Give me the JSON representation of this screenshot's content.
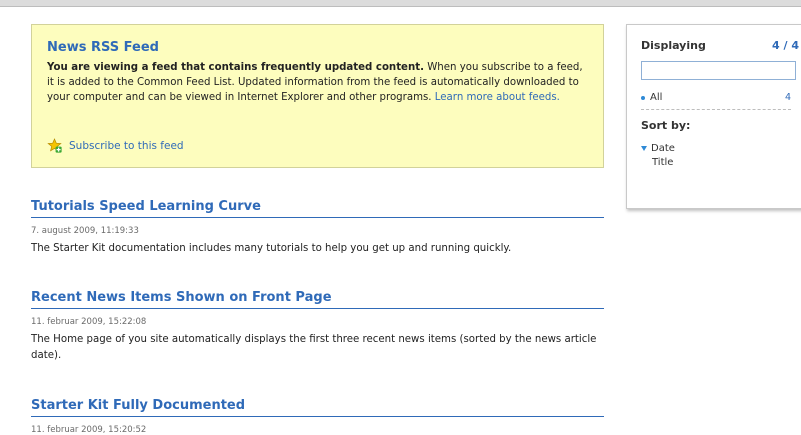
{
  "notice": {
    "title": "News RSS Feed",
    "bold_text": "You are viewing a feed that contains frequently updated content.",
    "text": " When you subscribe to a feed, it is added to the Common Feed List. Updated information from the feed is automatically downloaded to your computer and can be viewed in Internet Explorer and other programs. ",
    "learn_more": "Learn more about feeds.",
    "subscribe_label": "Subscribe to this feed"
  },
  "items": [
    {
      "title": "Tutorials Speed Learning Curve",
      "date": "7. august 2009, 11:19:33",
      "description": "The Starter Kit documentation includes many tutorials to help you get up and running quickly."
    },
    {
      "title": "Recent News Items Shown on Front Page",
      "date": "11. februar 2009, 15:22:08",
      "description": "The Home page of you site automatically displays the first three recent news items (sorted by the news article date)."
    },
    {
      "title": "Starter Kit Fully Documented",
      "date": "11. februar 2009, 15:20:52",
      "description": ""
    }
  ],
  "sidebar": {
    "displaying_label": "Displaying",
    "displaying_count": "4 / 4",
    "filter_value": "",
    "all_label": "All",
    "all_count": "4",
    "sort_label": "Sort by:",
    "sort_options": [
      "Date",
      "Title"
    ],
    "accent_color": "#2f6ab8"
  }
}
